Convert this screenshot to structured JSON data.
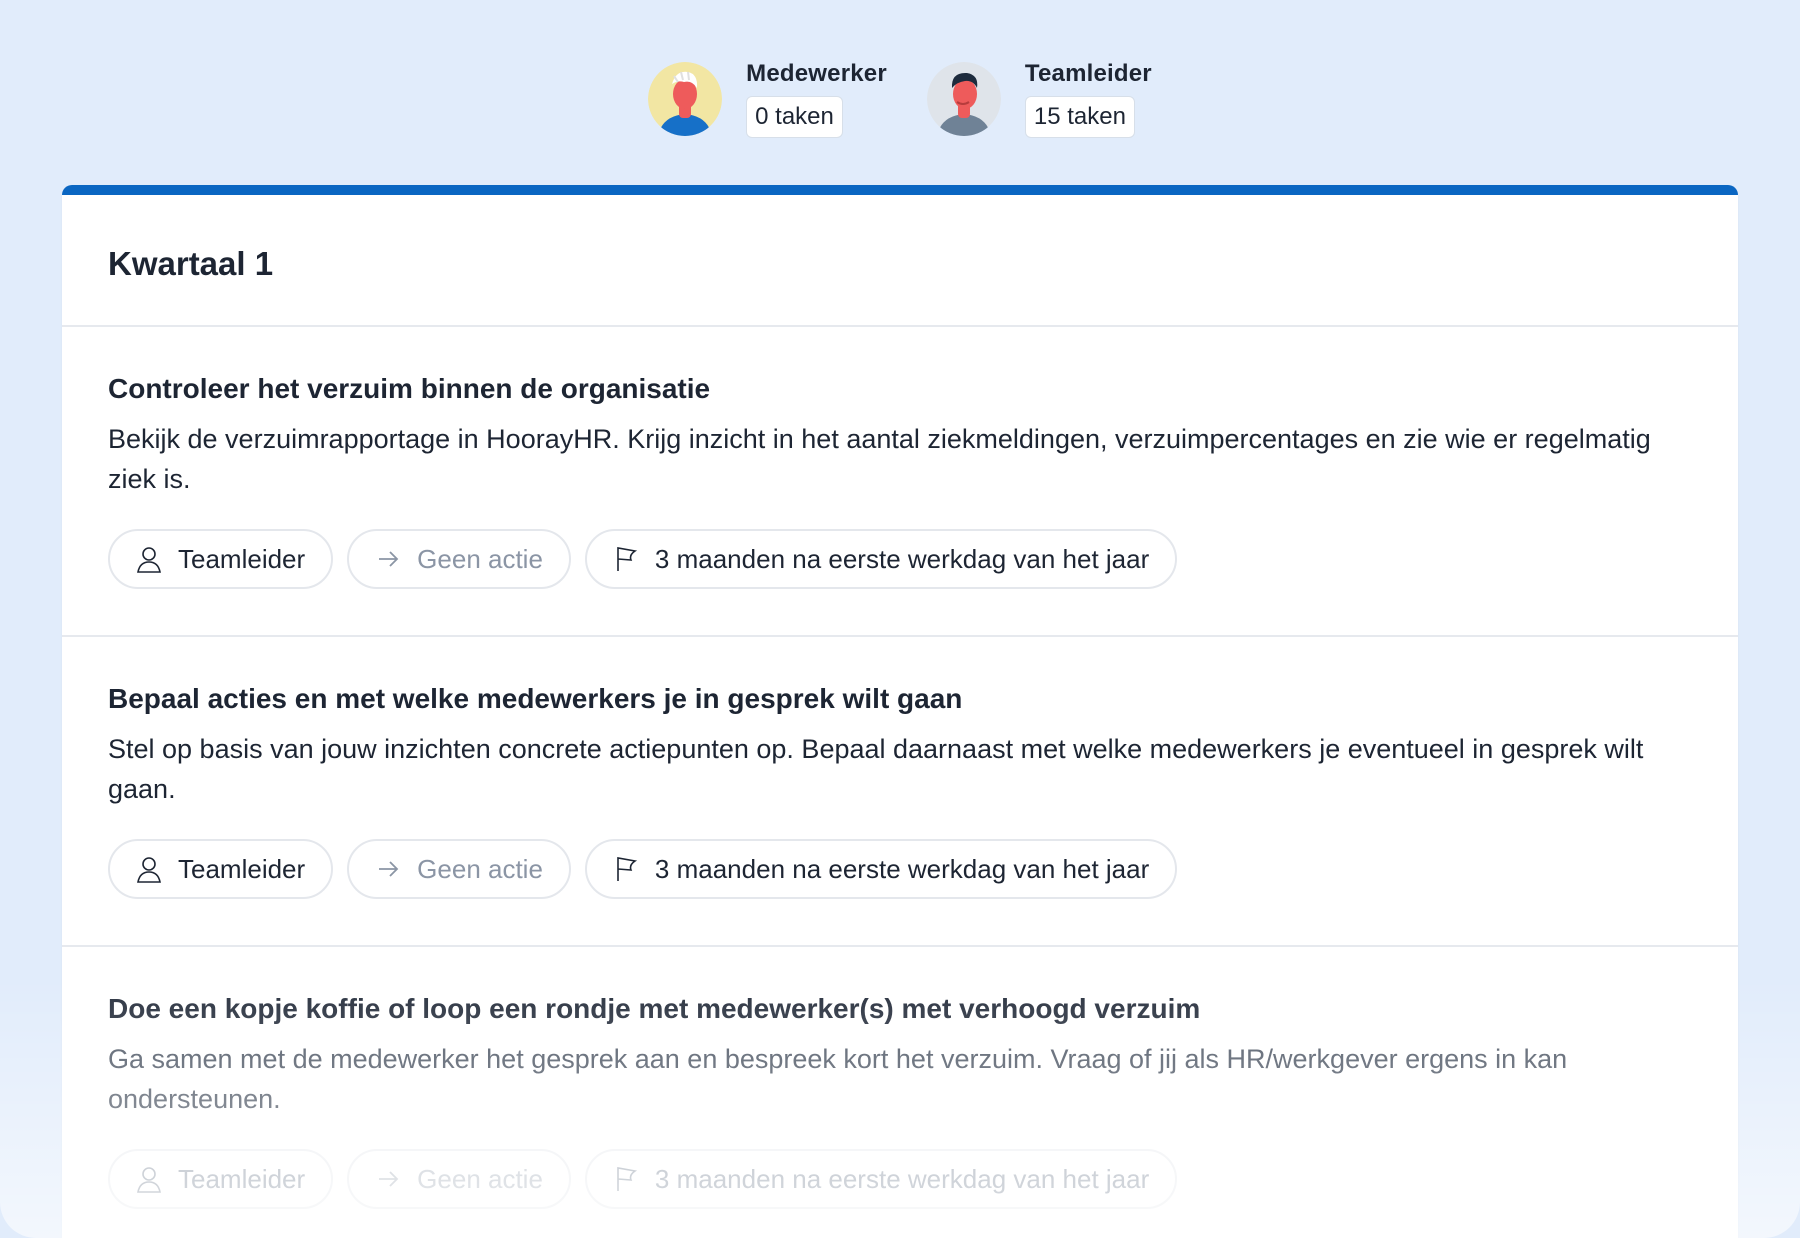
{
  "roles": [
    {
      "name": "Medewerker",
      "count": "0 taken",
      "avatar": "employee-avatar"
    },
    {
      "name": "Teamleider",
      "count": "15 taken",
      "avatar": "teamlead-avatar"
    }
  ],
  "colors": {
    "background": "#e1ecfb",
    "accent": "#0a66c2",
    "card": "#ffffff",
    "muted": "#8b95a5"
  },
  "card": {
    "title": "Kwartaal 1",
    "tasks": [
      {
        "title": "Controleer het verzuim binnen de organisatie",
        "description": "Bekijk de verzuimrapportage in HoorayHR. Krijg inzicht in het aantal ziekmeldingen, verzuimpercentages en zie wie er regelmatig ziek is.",
        "assignee": "Teamleider",
        "action": "Geen actie",
        "deadline": "3 maanden na eerste werkdag van het jaar"
      },
      {
        "title": "Bepaal acties en met welke medewerkers je in gesprek wilt gaan",
        "description": "Stel op basis van jouw inzichten concrete actiepunten op. Bepaal daarnaast met welke medewerkers je eventueel in gesprek wilt gaan.",
        "assignee": "Teamleider",
        "action": "Geen actie",
        "deadline": "3 maanden na eerste werkdag van het jaar"
      },
      {
        "title": "Doe een kopje koffie of loop een rondje met medewerker(s) met verhoogd verzuim",
        "description": "Ga samen met de medewerker het gesprek aan en bespreek kort het verzuim. Vraag of jij als HR/werkgever ergens in kan ondersteunen.",
        "assignee": "Teamleider",
        "action": "Geen actie",
        "deadline": "3 maanden na eerste werkdag van het jaar"
      }
    ]
  }
}
